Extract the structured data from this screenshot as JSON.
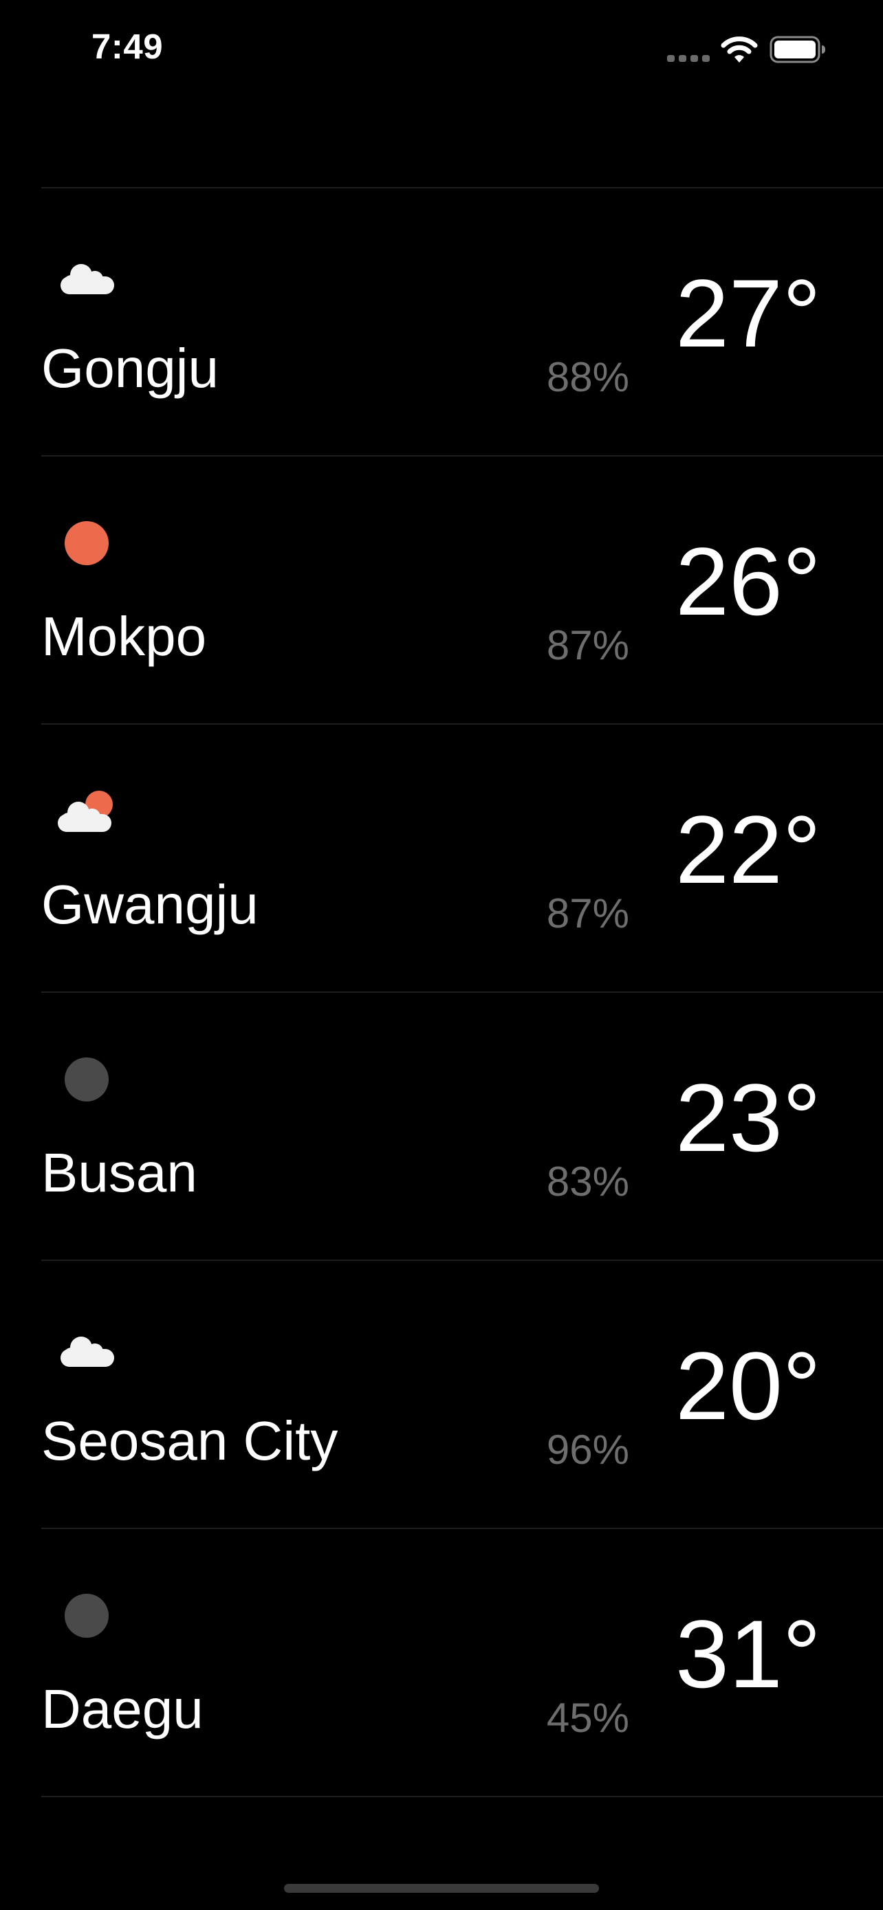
{
  "status_bar": {
    "time": "7:49",
    "signal_icon": "cellular-signal-icon",
    "wifi_icon": "wifi-icon",
    "battery_icon": "battery-icon"
  },
  "colors": {
    "background": "#000000",
    "text": "#ffffff",
    "muted": "#6e6e6e",
    "sun": "#ec6b4d",
    "moon": "#4a4a4a",
    "cloud": "#f2f2f2"
  },
  "cities": [
    {
      "name": "Gongju",
      "humidity": "88%",
      "temp": "27°",
      "icon": "cloud-icon"
    },
    {
      "name": "Mokpo",
      "humidity": "87%",
      "temp": "26°",
      "icon": "sun-icon"
    },
    {
      "name": "Gwangju",
      "humidity": "87%",
      "temp": "22°",
      "icon": "partly-cloudy-icon"
    },
    {
      "name": "Busan",
      "humidity": "83%",
      "temp": "23°",
      "icon": "moon-icon"
    },
    {
      "name": "Seosan City",
      "humidity": "96%",
      "temp": "20°",
      "icon": "cloud-icon"
    },
    {
      "name": "Daegu",
      "humidity": "45%",
      "temp": "31°",
      "icon": "moon-icon"
    }
  ]
}
